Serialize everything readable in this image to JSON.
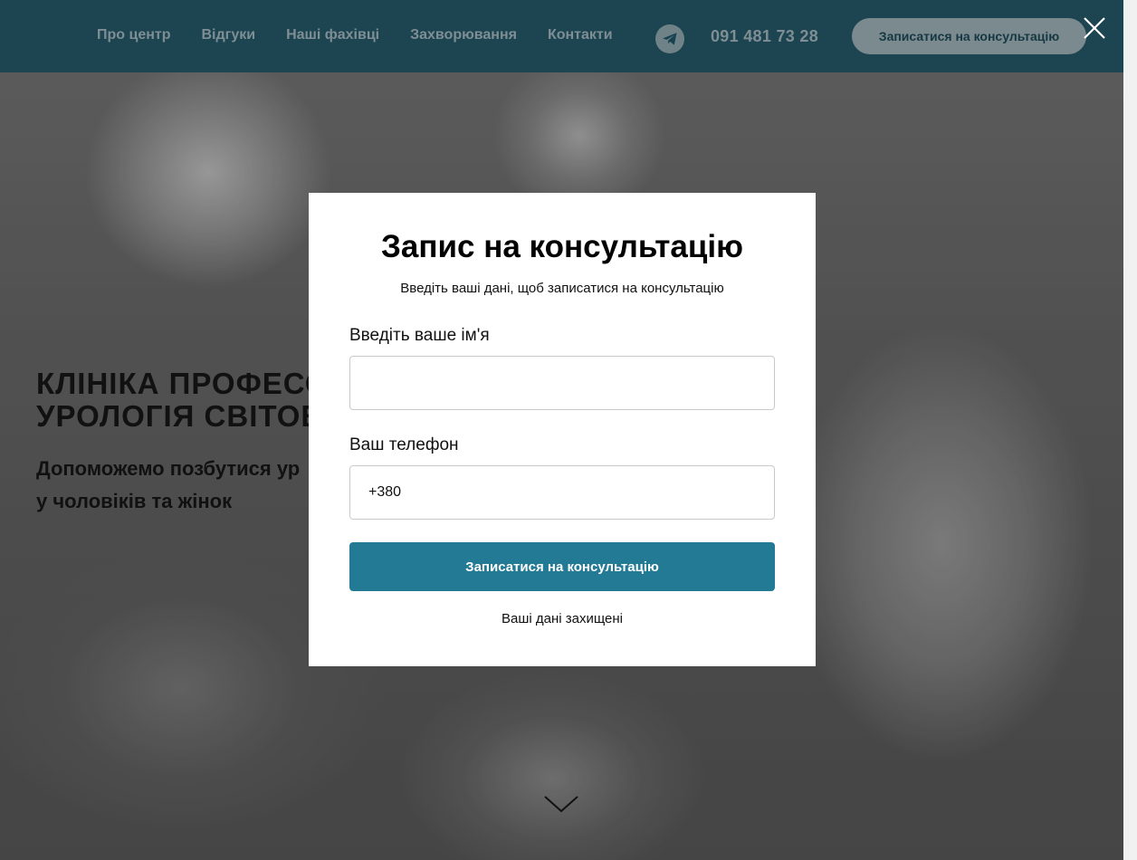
{
  "header": {
    "nav": [
      {
        "label": "Про центр"
      },
      {
        "label": "Відгуки"
      },
      {
        "label": "Наші фахівці"
      },
      {
        "label": "Захворювання"
      },
      {
        "label": "Контакти"
      }
    ],
    "phone": "091 481 73 28",
    "cta_label": "Записатися на консультацію",
    "telegram_icon": "telegram-icon",
    "close_icon": "close-icon"
  },
  "hero": {
    "title_line1": "КЛІНІКА ПРОФЕСО",
    "title_line2": "УРОЛОГІЯ СВІТОВ",
    "subtitle_line1": "Допоможемо позбутися ур",
    "subtitle_line2": "у чоловіків та жінок"
  },
  "modal": {
    "title": "Запис на консультацію",
    "subtitle": "Введіть ваші дані, щоб записатися на консультацію",
    "name_label": "Введіть ваше ім'я",
    "name_value": "",
    "phone_label": "Ваш телефон",
    "phone_value": "+380",
    "submit_label": "Записатися на консультацію",
    "privacy_note": "Ваші дані захищені"
  },
  "colors": {
    "header_bg": "#174350",
    "accent": "#237a94",
    "header_cta_bg": "#7b8a8f"
  }
}
